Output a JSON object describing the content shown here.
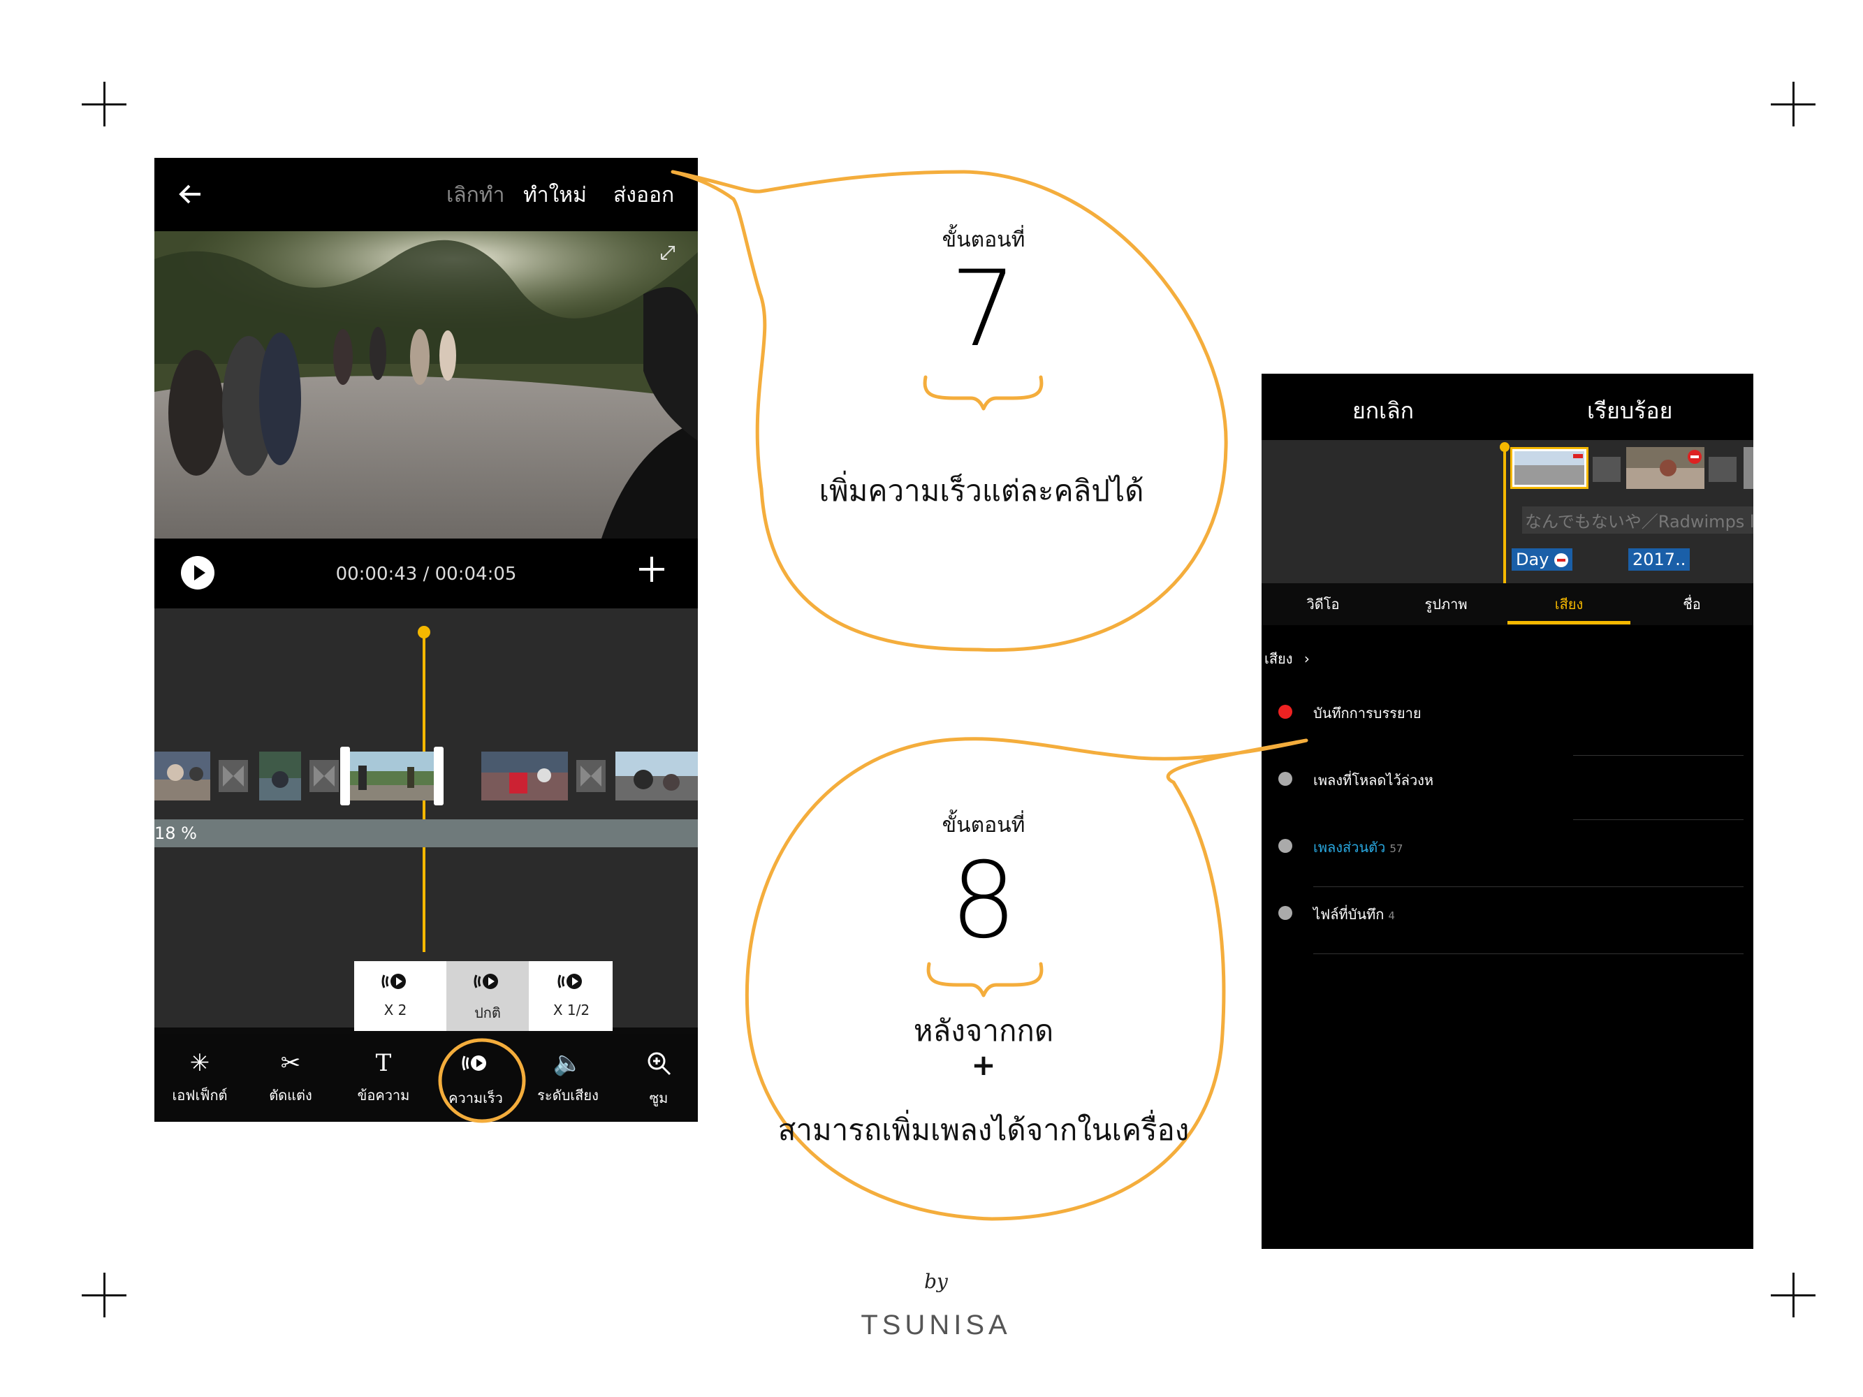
{
  "left_phone": {
    "top_bar": {
      "undo": "เลิกทำ",
      "redo": "ทำใหม่",
      "export": "ส่งออก"
    },
    "timecode": "00:00:43 / 00:04:05",
    "clip_percent": "18 %",
    "speed_options": [
      {
        "label": "X 2",
        "selected": false
      },
      {
        "label": "ปกติ",
        "selected": true
      },
      {
        "label": "X 1/2",
        "selected": false
      }
    ],
    "toolbar": [
      {
        "label": "เอฟเฟ็กต์",
        "icon": "sparkle-icon"
      },
      {
        "label": "ตัดแต่ง",
        "icon": "scissors-icon"
      },
      {
        "label": "ข้อความ",
        "icon": "text-icon"
      },
      {
        "label": "ความเร็ว",
        "icon": "speed-icon"
      },
      {
        "label": "ระดับเสียง",
        "icon": "volume-icon"
      },
      {
        "label": "ซูม",
        "icon": "zoom-icon"
      }
    ]
  },
  "right_phone": {
    "top_bar": {
      "cancel": "ยกเลิก",
      "done": "เรียบร้อย"
    },
    "music_track": "なんでもないや／Radwimps l",
    "tags": [
      "Day",
      "2017.."
    ],
    "tabs": [
      {
        "label": "วิดีโอ",
        "active": false
      },
      {
        "label": "รูปภาพ",
        "active": false
      },
      {
        "label": "เสียง",
        "active": true
      },
      {
        "label": "ชื่อ",
        "active": false
      }
    ],
    "breadcrumb": "เสียง",
    "rows": [
      {
        "label": "บันทึกการบรรยาย",
        "count": "",
        "color": "#e22"
      },
      {
        "label": "เพลงที่โหลดไว้ล่วงห",
        "count": "",
        "color": "#aaa"
      },
      {
        "label": "เพลงส่วนตัว",
        "count": "57",
        "color": "#aaa",
        "highlight": "#29a8e0"
      },
      {
        "label": "ไฟล์ที่บันทึก",
        "count": "4",
        "color": "#aaa"
      }
    ]
  },
  "annotations": {
    "step7": {
      "label": "ขั้นตอนที่",
      "number": "7",
      "desc": "เพิ่มความเร็วแต่ละคลิปได้"
    },
    "step8": {
      "label": "ขั้นตอนที่",
      "number": "8",
      "desc1": "หลังจากกด",
      "plus": "+",
      "desc2": "สามารถเพิ่มเพลงได้จากในเครื่อง"
    }
  },
  "credit": {
    "by": "by",
    "name": "TSUNISA"
  },
  "colors": {
    "accent": "#f5b800",
    "annotation": "#f4ad3c",
    "active_blue": "#29a8e0"
  }
}
